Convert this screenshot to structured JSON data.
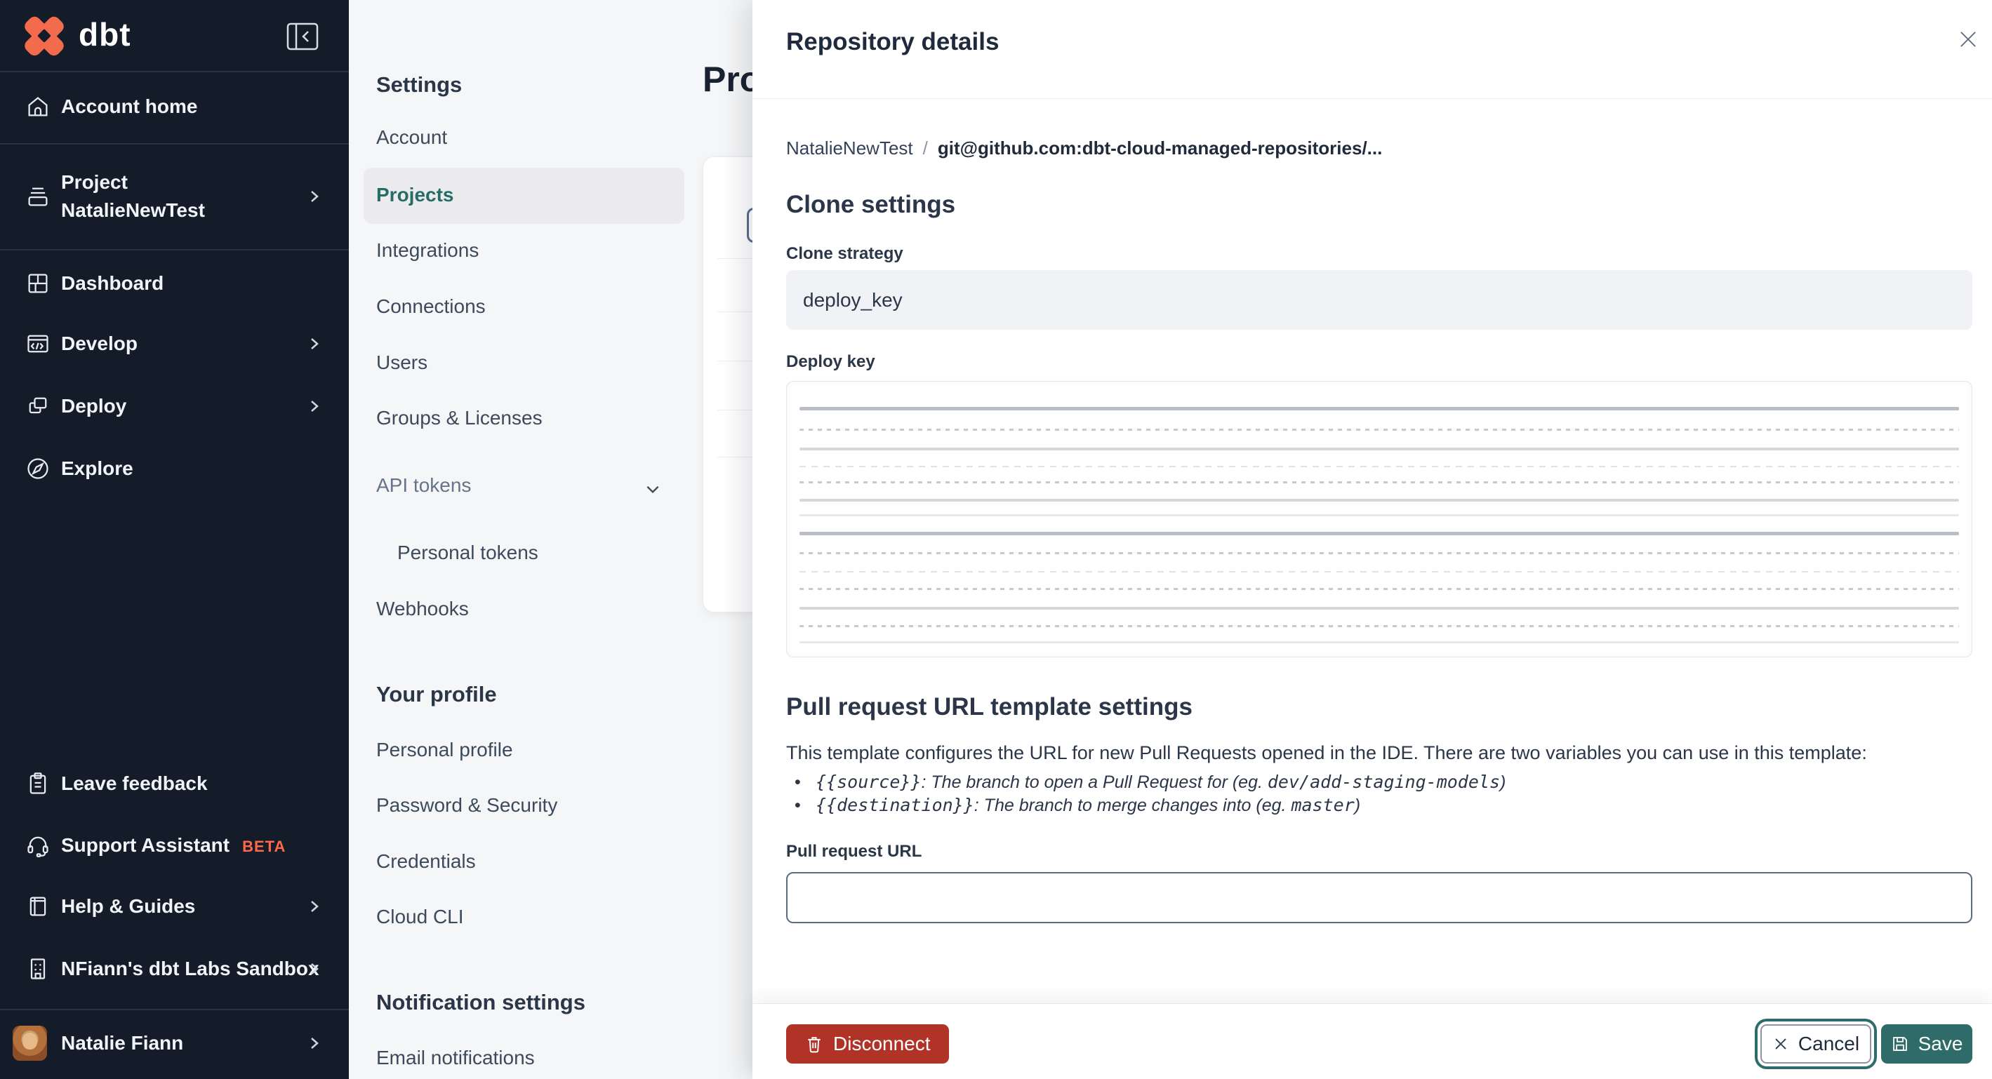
{
  "accent": {
    "teal": "#2f6b68",
    "orange": "#ff6948",
    "danger_red": "#b13327",
    "sidebar_bg": "#141b29"
  },
  "sidebar": {
    "logo_text": "dbt",
    "items": [
      {
        "label": "Account home"
      },
      {
        "line1": "Project",
        "line2": "NatalieNewTest"
      },
      {
        "label": "Dashboard"
      },
      {
        "label": "Develop"
      },
      {
        "label": "Deploy"
      },
      {
        "label": "Explore"
      }
    ],
    "footer_items": [
      {
        "label": "Leave feedback"
      },
      {
        "label": "Support Assistant",
        "badge": "BETA"
      },
      {
        "label": "Help & Guides"
      },
      {
        "label": "NFiann's dbt Labs Sandbox"
      }
    ],
    "user": {
      "name": "Natalie Fiann"
    }
  },
  "settings_nav": {
    "title": "Settings",
    "items": [
      {
        "label": "Account"
      },
      {
        "label": "Projects",
        "selected": true
      },
      {
        "label": "Integrations"
      },
      {
        "label": "Connections"
      },
      {
        "label": "Users"
      },
      {
        "label": "Groups & Licenses"
      },
      {
        "label": "API tokens"
      },
      {
        "label": "Personal tokens"
      },
      {
        "label": "Webhooks"
      }
    ],
    "profile_section": {
      "title": "Your profile",
      "items": [
        {
          "label": "Personal profile"
        },
        {
          "label": "Password & Security"
        },
        {
          "label": "Credentials"
        },
        {
          "label": "Cloud CLI"
        }
      ]
    },
    "notification_section": {
      "title": "Notification settings",
      "items": [
        {
          "label": "Email notifications"
        }
      ]
    }
  },
  "main": {
    "heading": "Projects"
  },
  "drawer": {
    "title": "Repository details",
    "breadcrumb": {
      "project": "NatalieNewTest",
      "separator": "/",
      "repo": "git@github.com:dbt-cloud-managed-repositories/..."
    },
    "clone_settings": {
      "heading": "Clone settings",
      "clone_strategy_label": "Clone strategy",
      "clone_strategy_value": "deploy_key",
      "deploy_key_label": "Deploy key"
    },
    "pr_template": {
      "heading": "Pull request URL template settings",
      "description": "This template configures the URL for new Pull Requests opened in the IDE. There are two variables you can use in this template:",
      "bullets": [
        {
          "code": "{{source}}",
          "text": ": The branch to open a Pull Request for (eg. ",
          "example": "dev/add-staging-models",
          "suffix": ")"
        },
        {
          "code": "{{destination}}",
          "text": ": The branch to merge changes into (eg. ",
          "example": "master",
          "suffix": ")"
        }
      ],
      "pr_url_label": "Pull request URL",
      "pr_url_value": ""
    },
    "footer": {
      "disconnect": "Disconnect",
      "cancel": "Cancel",
      "save": "Save"
    }
  }
}
